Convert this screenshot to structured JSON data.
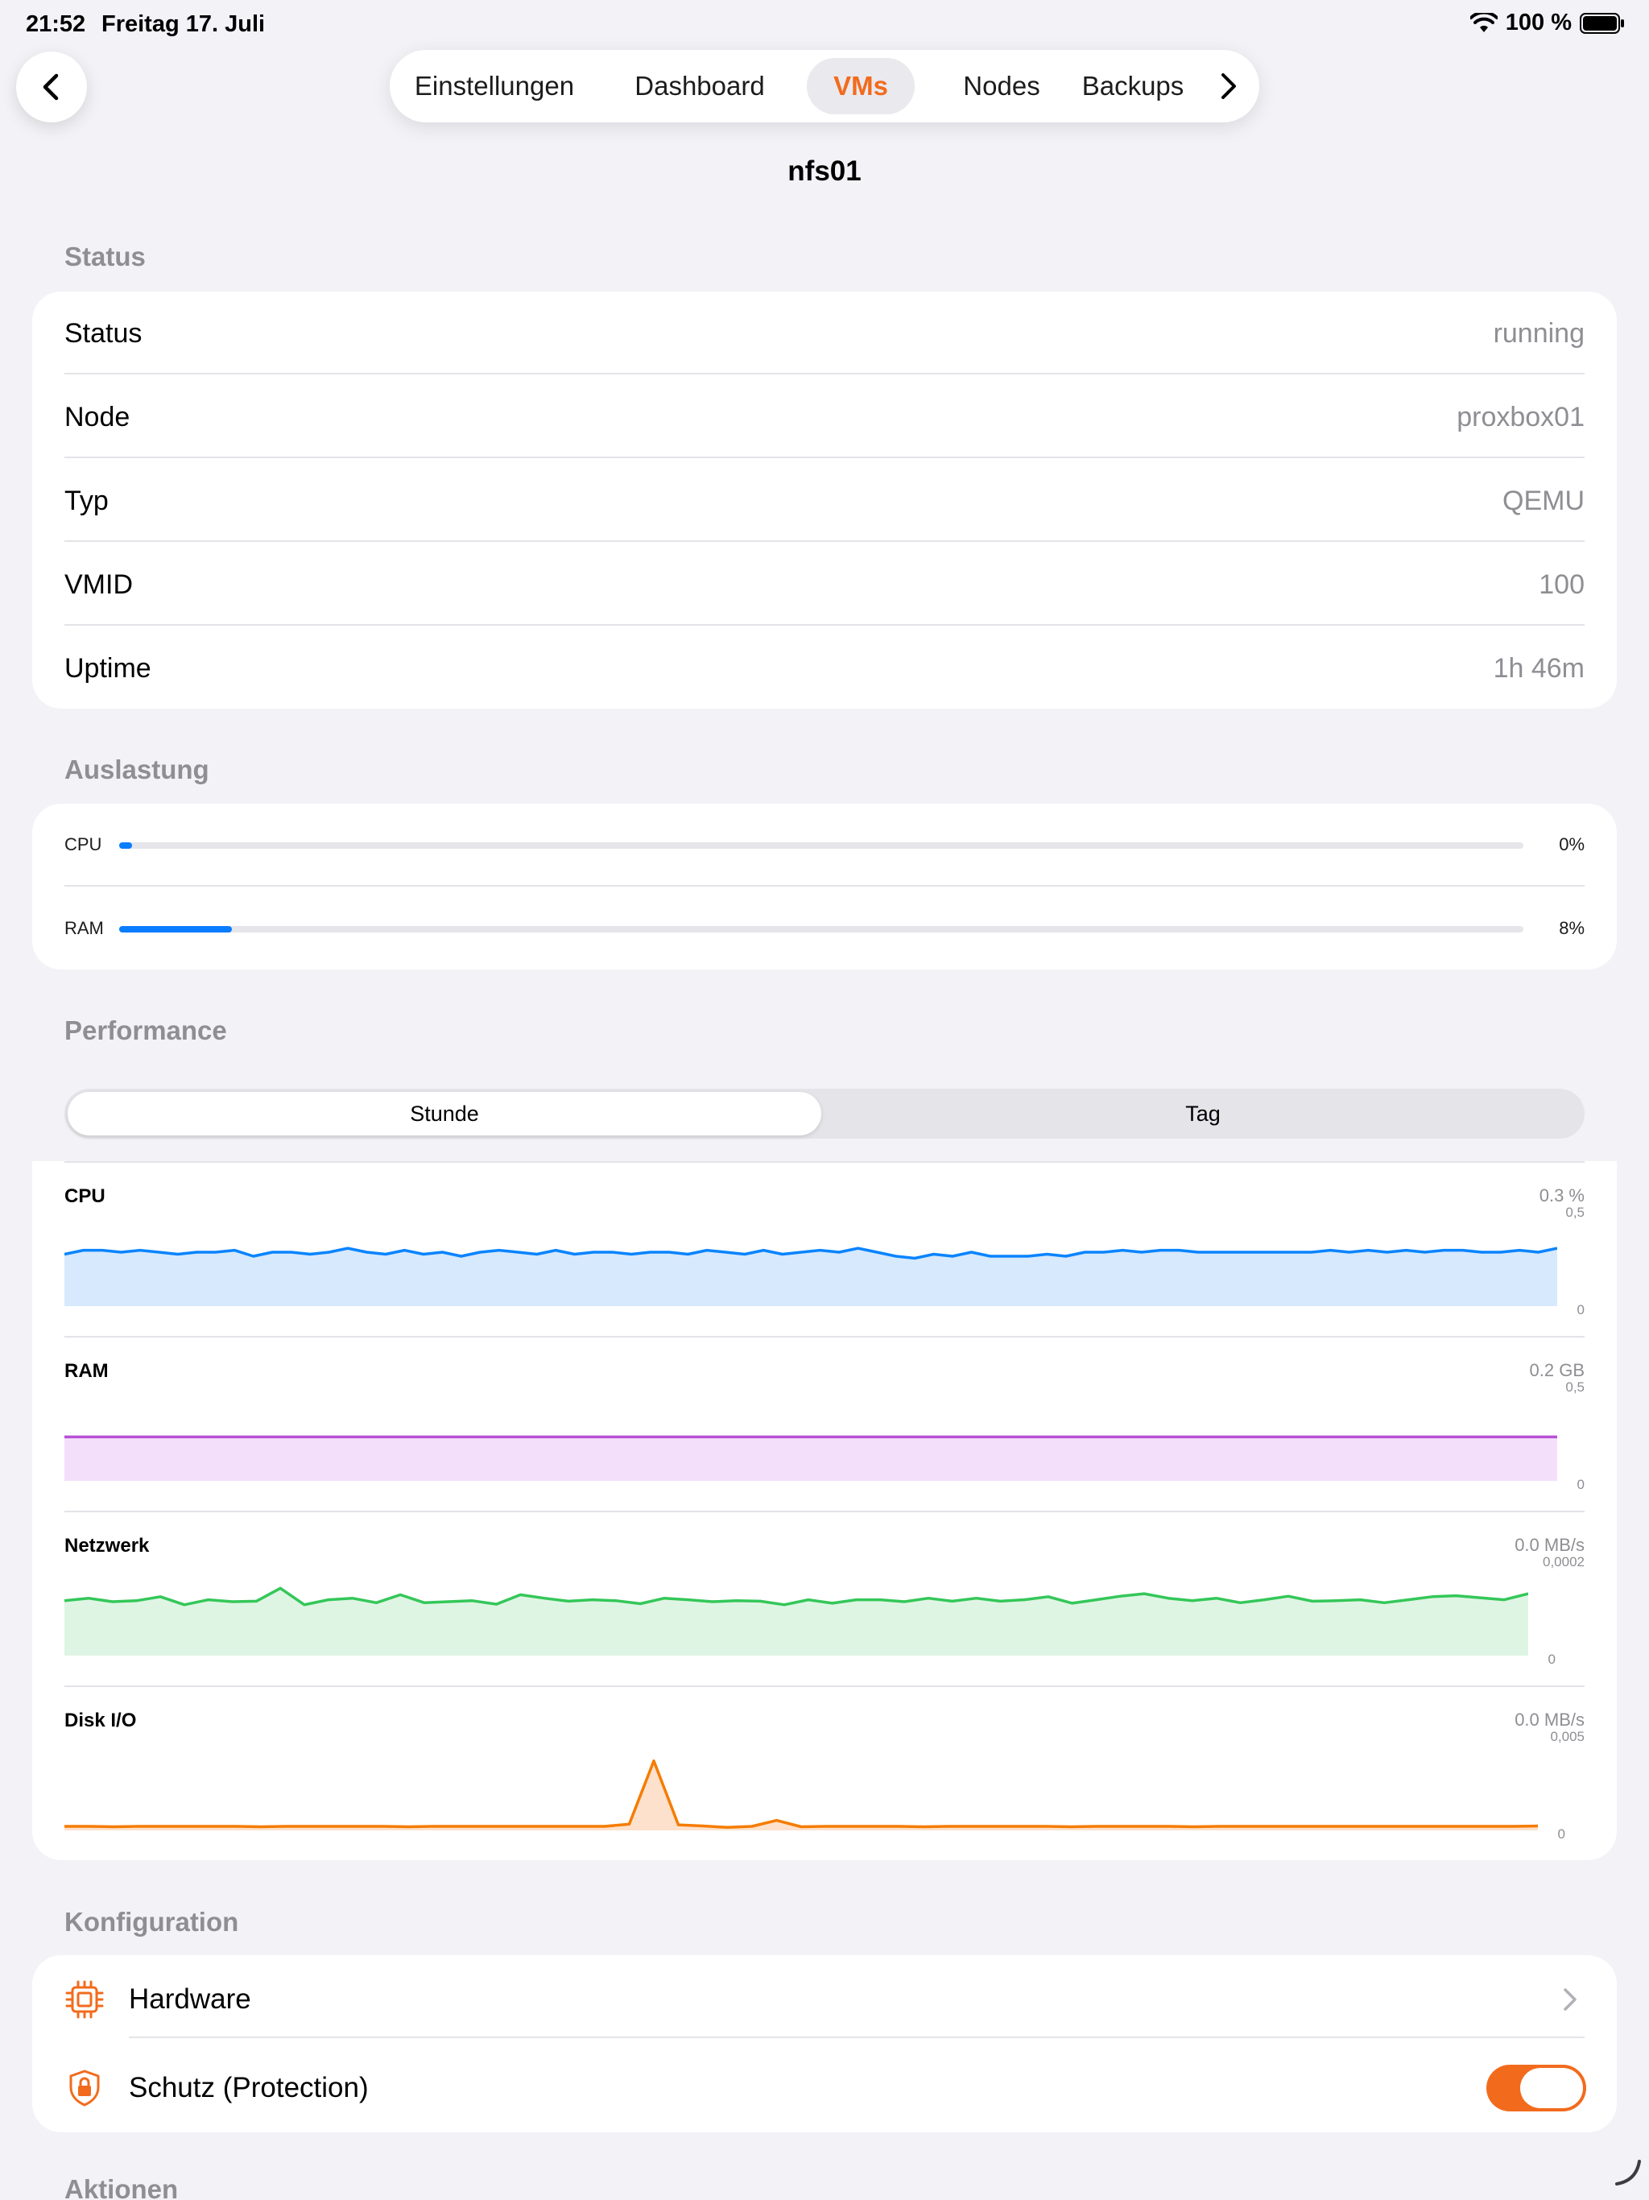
{
  "status_bar": {
    "time": "21:52",
    "date": "Freitag 17. Juli",
    "battery": "100 %"
  },
  "nav": {
    "back_icon": "chevron-left-icon",
    "tabs": [
      {
        "label": "Einstellungen",
        "active": false
      },
      {
        "label": "Dashboard",
        "active": false
      },
      {
        "label": "VMs",
        "active": true
      },
      {
        "label": "Nodes",
        "active": false
      },
      {
        "label": "Backups",
        "active": false
      }
    ],
    "more_icon": "chevron-right-icon"
  },
  "title": "nfs01",
  "status_section": {
    "header": "Status",
    "rows": [
      {
        "label": "Status",
        "value": "running"
      },
      {
        "label": "Node",
        "value": "proxbox01"
      },
      {
        "label": "Typ",
        "value": "QEMU"
      },
      {
        "label": "VMID",
        "value": "100"
      },
      {
        "label": "Uptime",
        "value": "1h 46m"
      }
    ]
  },
  "usage_section": {
    "header": "Auslastung",
    "items": [
      {
        "label": "CPU",
        "value": "0%",
        "percent": 0
      },
      {
        "label": "RAM",
        "value": "8%",
        "percent": 8
      }
    ],
    "color": "#0a7cff"
  },
  "performance_section": {
    "header": "Performance",
    "segments": [
      "Stunde",
      "Tag"
    ],
    "selected_segment": "Stunde"
  },
  "chart_data": [
    {
      "type": "area",
      "title": "CPU",
      "current": "0.3 %",
      "ymax_label": "0,5",
      "ymin_label": "0",
      "ylim": [
        0,
        0.5
      ],
      "color": "#0a84ff",
      "fill": "#d7e9fc",
      "values": [
        0.26,
        0.28,
        0.28,
        0.27,
        0.28,
        0.27,
        0.26,
        0.27,
        0.27,
        0.28,
        0.25,
        0.27,
        0.27,
        0.26,
        0.27,
        0.29,
        0.27,
        0.26,
        0.28,
        0.26,
        0.27,
        0.25,
        0.27,
        0.28,
        0.27,
        0.26,
        0.28,
        0.26,
        0.27,
        0.27,
        0.26,
        0.27,
        0.27,
        0.26,
        0.28,
        0.27,
        0.26,
        0.28,
        0.26,
        0.27,
        0.28,
        0.27,
        0.29,
        0.27,
        0.25,
        0.24,
        0.26,
        0.25,
        0.27,
        0.25,
        0.25,
        0.25,
        0.26,
        0.25,
        0.27,
        0.27,
        0.28,
        0.27,
        0.28,
        0.28,
        0.27,
        0.27,
        0.27,
        0.27,
        0.27,
        0.27,
        0.27,
        0.28,
        0.27,
        0.28,
        0.27,
        0.28,
        0.27,
        0.28,
        0.28,
        0.27,
        0.27,
        0.28,
        0.27,
        0.29
      ]
    },
    {
      "type": "area",
      "title": "RAM",
      "current": "0.2 GB",
      "ymax_label": "0,5",
      "ymin_label": "0",
      "ylim": [
        0,
        0.5
      ],
      "color": "#b84fd6",
      "fill": "#f4dffa",
      "values": [
        0.22,
        0.22
      ]
    },
    {
      "type": "area",
      "title": "Netzwerk",
      "current": "0.0 MB/s",
      "ymax_label": "0,0002",
      "ymin_label": "0",
      "ylim": [
        0,
        0.0002
      ],
      "color": "#34c759",
      "fill": "#dff5e4",
      "values": [
        0.00011,
        0.000115,
        0.000108,
        0.00011,
        0.000118,
        0.000102,
        0.000112,
        0.000108,
        0.000109,
        0.000135,
        0.000102,
        0.000112,
        0.000115,
        0.000106,
        0.000122,
        0.000106,
        0.000108,
        0.00011,
        0.000103,
        0.000122,
        0.000115,
        0.000109,
        0.000112,
        0.00011,
        0.000104,
        0.000115,
        0.000112,
        0.000108,
        0.00011,
        0.000109,
        0.000102,
        0.000112,
        0.000105,
        0.000112,
        0.000112,
        0.000108,
        0.000115,
        0.000109,
        0.000115,
        0.000109,
        0.000112,
        0.000118,
        0.000105,
        0.000112,
        0.000119,
        0.000124,
        0.000115,
        0.00011,
        0.000115,
        0.000106,
        0.000112,
        0.000119,
        0.000109,
        0.00011,
        0.000112,
        0.000106,
        0.000112,
        0.000118,
        0.00012,
        0.000116,
        0.000112,
        0.000124
      ]
    },
    {
      "type": "area",
      "title": "Disk I/O",
      "current": "0.0 MB/s",
      "ymax_label": "0,005",
      "ymin_label": "0",
      "ylim": [
        0,
        0.005
      ],
      "color": "#f57c00",
      "fill": "#fde1cc",
      "values": [
        0.0002,
        0.0002,
        0.00018,
        0.0002,
        0.0002,
        0.0002,
        0.0002,
        0.0002,
        0.00018,
        0.0002,
        0.0002,
        0.0002,
        0.0002,
        0.0002,
        0.00018,
        0.0002,
        0.0002,
        0.0002,
        0.0002,
        0.0002,
        0.0002,
        0.0002,
        0.0002,
        0.00031,
        0.00348,
        0.00028,
        0.00022,
        0.00015,
        0.0002,
        0.0005,
        0.00018,
        0.0002,
        0.0002,
        0.0002,
        0.0002,
        0.00018,
        0.0002,
        0.0002,
        0.0002,
        0.0002,
        0.0002,
        0.00018,
        0.0002,
        0.0002,
        0.0002,
        0.0002,
        0.00018,
        0.0002,
        0.0002,
        0.0002,
        0.0002,
        0.0002,
        0.0002,
        0.0002,
        0.0002,
        0.0002,
        0.0002,
        0.0002,
        0.0002,
        0.0002,
        0.00022
      ]
    }
  ],
  "config_section": {
    "header": "Konfiguration",
    "rows": [
      {
        "label": "Hardware",
        "icon": "cpu-chip-icon",
        "accessory": "chevron-right-icon"
      },
      {
        "label": "Schutz (Protection)",
        "icon": "lock-shield-icon",
        "toggle_on": true
      }
    ],
    "accent": "#f26b1d"
  },
  "actions_section": {
    "header": "Aktionen"
  }
}
